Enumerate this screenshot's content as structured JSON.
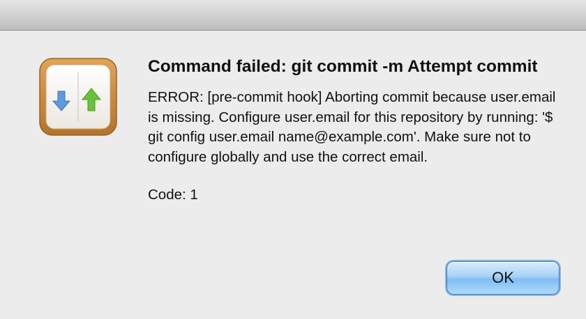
{
  "dialog": {
    "title": "Command failed: git commit -m Attempt commit",
    "message": "ERROR: [pre-commit hook] Aborting commit because user.email is missing. Configure user.email for this repository by running: '$ git config user.email name@example.com'. Make sure not to configure globally and use the correct email.",
    "code_text": "Code: 1",
    "ok_label": "OK"
  },
  "icon": {
    "name": "git-push-pull-app-icon",
    "frame_color": "#c98a3e",
    "down_arrow_color": "#5d9ae0",
    "up_arrow_color": "#6cc13a"
  },
  "colors": {
    "background": "#ececec",
    "button_accent": "#7fbdf2"
  }
}
